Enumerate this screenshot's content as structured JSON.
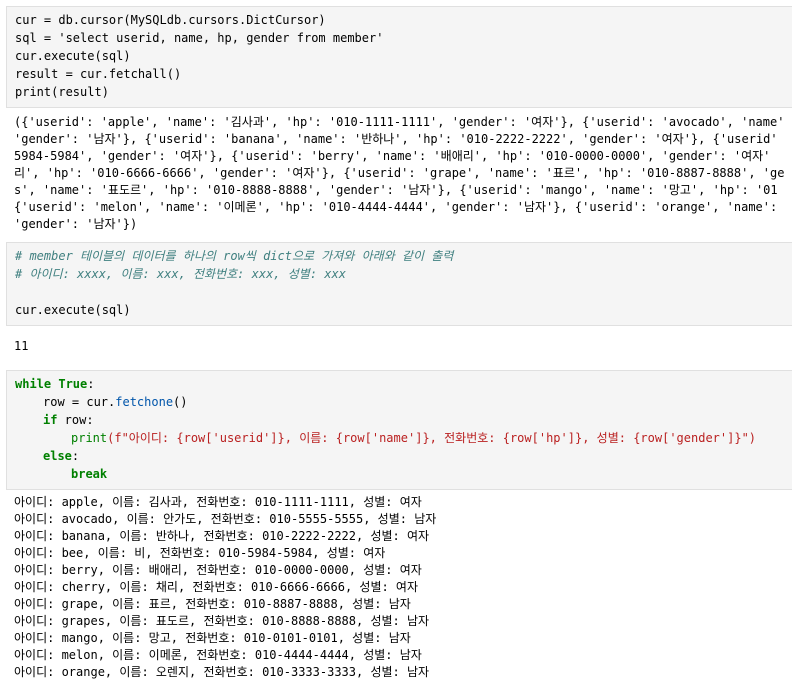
{
  "cell1": {
    "lines": [
      "cur = db.cursor(MySQLdb.cursors.DictCursor)",
      "sql = 'select userid, name, hp, gender from member'",
      "cur.execute(sql)",
      "result = cur.fetchall()",
      "print(result)"
    ]
  },
  "output1": {
    "lines": [
      "({'userid': 'apple', 'name': '김사과', 'hp': '010-1111-1111', 'gender': '여자'}, {'userid': 'avocado', 'name'",
      "'gender': '남자'}, {'userid': 'banana', 'name': '반하나', 'hp': '010-2222-2222', 'gender': '여자'}, {'userid'",
      "5984-5984', 'gender': '여자'}, {'userid': 'berry', 'name': '배애리', 'hp': '010-0000-0000', 'gender': '여자'",
      "리', 'hp': '010-6666-6666', 'gender': '여자'}, {'userid': 'grape', 'name': '표르', 'hp': '010-8887-8888', 'ge",
      "s', 'name': '표도르', 'hp': '010-8888-8888', 'gender': '남자'}, {'userid': 'mango', 'name': '망고', 'hp': '01",
      "{'userid': 'melon', 'name': '이메론', 'hp': '010-4444-4444', 'gender': '남자'}, {'userid': 'orange', 'name':",
      "'gender': '남자'})"
    ]
  },
  "cell2": {
    "comment1": "# member 테이블의 데이터를 하나의 row씩 dict으로 가져와 아래와 같이 출력",
    "comment2": "# 아이디: xxxx, 이름: xxx, 전화번호: xxx, 성별: xxx",
    "code": "cur.execute(sql)"
  },
  "output2": {
    "value": "11"
  },
  "cell3": {
    "l1_kw": "while",
    "l1_true": "True",
    "l1_colon": ":",
    "l2": "row = cur.",
    "l2_fn": "fetchone",
    "l2_end": "()",
    "l3_kw": "if",
    "l3_rest": " row:",
    "l4_print": "print",
    "l4_a": "(f\"아이디: {row[",
    "l4_k1": "'userid'",
    "l4_b": "]}, 이름: {row[",
    "l4_k2": "'name'",
    "l4_c": "]}, 전화번호: {row[",
    "l4_k3": "'hp'",
    "l4_d": "]}, 성별: {row[",
    "l4_k4": "'gender'",
    "l4_e": "]}\")",
    "l5_kw": "else",
    "l5_colon": ":",
    "l6_kw": "break"
  },
  "output3": {
    "lines": [
      "아이디: apple, 이름: 김사과, 전화번호: 010-1111-1111, 성별: 여자",
      "아이디: avocado, 이름: 안가도, 전화번호: 010-5555-5555, 성별: 남자",
      "아이디: banana, 이름: 반하나, 전화번호: 010-2222-2222, 성별: 여자",
      "아이디: bee, 이름: 비, 전화번호: 010-5984-5984, 성별: 여자",
      "아이디: berry, 이름: 배애리, 전화번호: 010-0000-0000, 성별: 여자",
      "아이디: cherry, 이름: 채리, 전화번호: 010-6666-6666, 성별: 여자",
      "아이디: grape, 이름: 표르, 전화번호: 010-8887-8888, 성별: 남자",
      "아이디: grapes, 이름: 표도르, 전화번호: 010-8888-8888, 성별: 남자",
      "아이디: mango, 이름: 망고, 전화번호: 010-0101-0101, 성별: 남자",
      "아이디: melon, 이름: 이메론, 전화번호: 010-4444-4444, 성별: 남자",
      "아이디: orange, 이름: 오렌지, 전화번호: 010-3333-3333, 성별: 남자"
    ]
  }
}
